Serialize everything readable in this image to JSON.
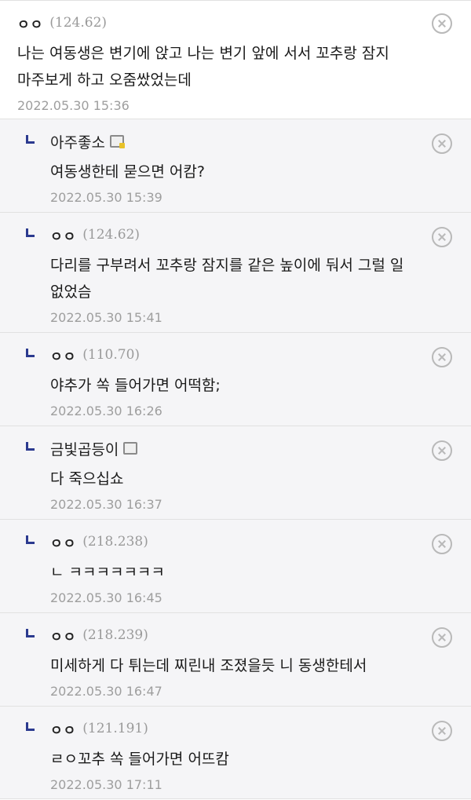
{
  "comments": [
    {
      "nick": "ㅇㅇ",
      "ip": "(124.62)",
      "body": "나는 여동생은 변기에 앉고 나는 변기 앞에 서서 꼬추랑 잠지 마주보게 하고 오줌쌌었는데",
      "date": "2022.05.30 15:36"
    },
    {
      "nick": "아주좋소",
      "ip": "",
      "body": "여동생한테 묻으면 어캄?",
      "date": "2022.05.30 15:39"
    },
    {
      "nick": "ㅇㅇ",
      "ip": "(124.62)",
      "body": "다리를 구부려서 꼬추랑 잠지를 같은 높이에 둬서 그럴 일 없었슴",
      "date": "2022.05.30 15:41"
    },
    {
      "nick": "ㅇㅇ",
      "ip": "(110.70)",
      "body": "야추가 쏙 들어가면 어떡함;",
      "date": "2022.05.30 16:26"
    },
    {
      "nick": "금빛곱등이",
      "ip": "",
      "body": "다 죽으십쇼",
      "date": "2022.05.30 16:37"
    },
    {
      "nick": "ㅇㅇ",
      "ip": "(218.238)",
      "body": "ㄴ ㅋㅋㅋㅋㅋㅋㅋ",
      "date": "2022.05.30 16:45"
    },
    {
      "nick": "ㅇㅇ",
      "ip": "(218.239)",
      "body": "미세하게 다 튀는데 찌린내 조졌을듯 니 동생한테서",
      "date": "2022.05.30 16:47"
    },
    {
      "nick": "ㅇㅇ",
      "ip": "(121.191)",
      "body": "ㄹㅇ꼬추 쏙 들어가면 어뜨캄",
      "date": "2022.05.30 17:11"
    }
  ],
  "icons": {
    "delete": "close-circle-icon",
    "reply": "reply-arrow-icon",
    "member_fixed": "fixed-member-icon",
    "member_half": "half-member-icon"
  },
  "colors": {
    "reply_bg": "#f5f5f7",
    "reply_arrow": "#2b3a8f",
    "meta_text": "#9e9e9e"
  }
}
